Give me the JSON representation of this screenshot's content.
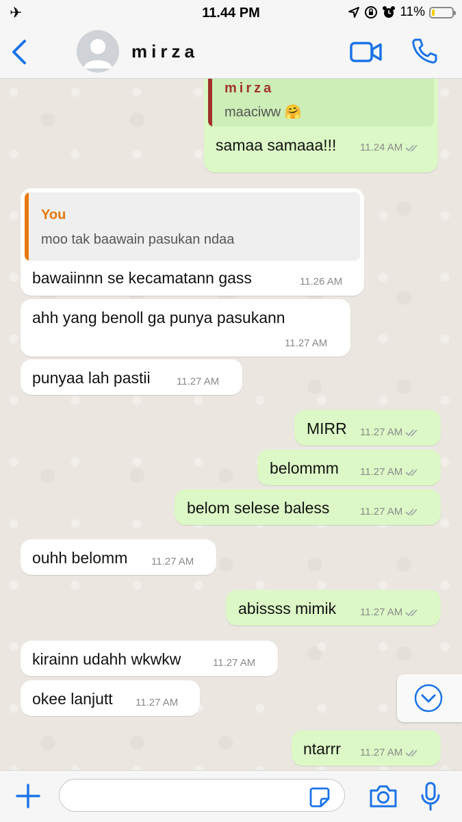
{
  "status": {
    "time": "11.44 PM",
    "battery": "11%"
  },
  "header": {
    "contact_name": "mirza"
  },
  "messages": [
    {
      "quote_name": "mirza",
      "quote_text": "maaciww 🤗",
      "text": "samaa samaaa!!!",
      "time": "11.24 AM"
    },
    {
      "quote_name": "You",
      "quote_text": "moo tak baawain pasukan ndaa",
      "text": "bawaiinnn se kecamatann gass",
      "time": "11.26 AM"
    },
    {
      "text": "ahh yang benoll ga punya pasukann",
      "time": "11.27 AM"
    },
    {
      "text": "punyaa lah pastii",
      "time": "11.27 AM"
    },
    {
      "text": "MIRR",
      "time": "11.27 AM"
    },
    {
      "text": "belommm",
      "time": "11.27 AM"
    },
    {
      "text": "belom selese baless",
      "time": "11.27 AM"
    },
    {
      "text": "ouhh belomm",
      "time": "11.27 AM"
    },
    {
      "text": "abissss mimik",
      "time": "11.27 AM"
    },
    {
      "text": "kirainn udahh wkwkw",
      "time": "11.27 AM"
    },
    {
      "text": "okee lanjutt",
      "time": "11.27 AM"
    },
    {
      "text": "ntarrr",
      "time": "11.27 AM"
    }
  ],
  "colors": {
    "accent": "#1a73e8",
    "outgoing": "#dcf8c6",
    "incoming": "#ffffff",
    "quote_contact": "#a0332a",
    "quote_you": "#e8780e"
  },
  "input": {
    "placeholder": ""
  }
}
